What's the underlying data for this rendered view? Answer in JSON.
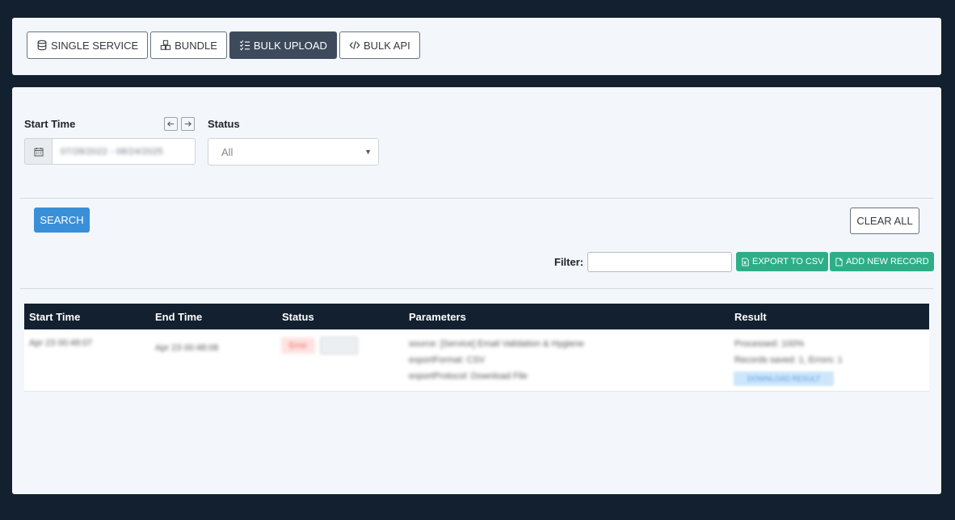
{
  "tabs": [
    {
      "label": "SINGLE SERVICE",
      "icon": "database-icon",
      "active": false
    },
    {
      "label": "BUNDLE",
      "icon": "boxes-icon",
      "active": false
    },
    {
      "label": "BULK UPLOAD",
      "icon": "list-check-icon",
      "active": true
    },
    {
      "label": "BULK API",
      "icon": "code-icon",
      "active": false
    }
  ],
  "filters": {
    "start_time_label": "Start Time",
    "start_time_value": "07/28/2022 - 08/24/2025",
    "status_label": "Status",
    "status_value": "All"
  },
  "actions": {
    "search_label": "SEARCH",
    "clear_label": "CLEAR ALL",
    "filter_label": "Filter:",
    "filter_value": "",
    "export_label": "EXPORT TO CSV",
    "add_label": "ADD NEW RECORD"
  },
  "table": {
    "columns": [
      "Start Time",
      "End Time",
      "Status",
      "Parameters",
      "Result"
    ],
    "rows": [
      {
        "start_time": "Apr 23 00:48:07",
        "end_time": "Apr 23 00:48:08",
        "status": "Error",
        "params": [
          "source: [Service] Email Validation & Hygiene",
          "exportFormat: CSV",
          "exportProtocol: Download File"
        ],
        "result": [
          "Processed: 100%",
          "Records saved: 1, Errors: 1"
        ],
        "download_label": "DOWNLOAD RESULT"
      }
    ]
  },
  "colors": {
    "background": "#12202f",
    "card": "#f3f6fb",
    "primary": "#3a8fd9",
    "success": "#2eae87",
    "active_tab": "#3d4a5c"
  }
}
